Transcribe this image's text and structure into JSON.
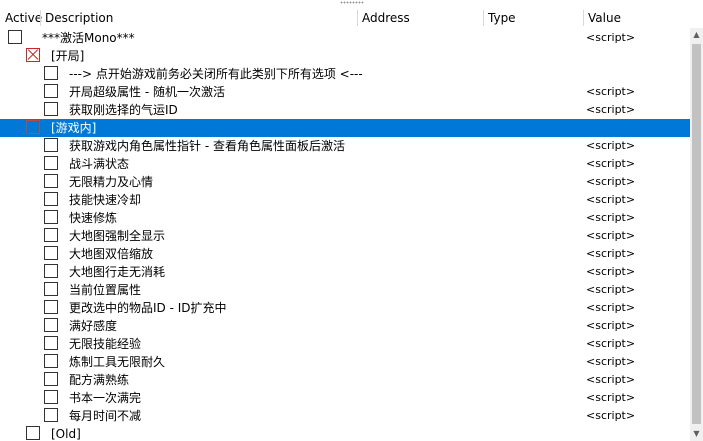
{
  "columns": {
    "active": "Active",
    "description": "Description",
    "address": "Address",
    "type": "Type",
    "value": "Value"
  },
  "rows": [
    {
      "desc": "***激活Mono***",
      "value": "<script>",
      "checked": false
    },
    {
      "desc": "[开局]",
      "value": "",
      "checked": true
    },
    {
      "desc": "--->      点开始游戏前务必关闭所有此类别下所有选项      <---",
      "value": "",
      "checked": false
    },
    {
      "desc": "开局超级属性 - 随机一次激活",
      "value": "<script>",
      "checked": false
    },
    {
      "desc": "获取刚选择的气运ID",
      "value": "<script>",
      "checked": false
    },
    {
      "desc": "[游戏内]",
      "value": "",
      "checked": false,
      "selected": true
    },
    {
      "desc": "获取游戏内角色属性指针 - 查看角色属性面板后激活",
      "value": "<script>",
      "checked": false
    },
    {
      "desc": "战斗满状态",
      "value": "<script>",
      "checked": false
    },
    {
      "desc": "无限精力及心情",
      "value": "<script>",
      "checked": false
    },
    {
      "desc": "技能快速冷却",
      "value": "<script>",
      "checked": false
    },
    {
      "desc": "快速修炼",
      "value": "<script>",
      "checked": false
    },
    {
      "desc": "大地图强制全显示",
      "value": "<script>",
      "checked": false
    },
    {
      "desc": "大地图双倍缩放",
      "value": "<script>",
      "checked": false
    },
    {
      "desc": "大地图行走无消耗",
      "value": "<script>",
      "checked": false
    },
    {
      "desc": "当前位置属性",
      "value": "<script>",
      "checked": false
    },
    {
      "desc": "更改选中的物品ID - ID扩充中",
      "value": "<script>",
      "checked": false
    },
    {
      "desc": "满好感度",
      "value": "<script>",
      "checked": false
    },
    {
      "desc": "无限技能经验",
      "value": "<script>",
      "checked": false
    },
    {
      "desc": "炼制工具无限耐久",
      "value": "<script>",
      "checked": false
    },
    {
      "desc": "配方满熟练",
      "value": "<script>",
      "checked": false
    },
    {
      "desc": "书本一次满完",
      "value": "<script>",
      "checked": false
    },
    {
      "desc": "每月时间不减",
      "value": "<script>",
      "checked": false
    },
    {
      "desc": "[Old]",
      "value": "",
      "checked": false
    }
  ],
  "scrollbar": {
    "up_icon": "arrow-up",
    "down_icon": "arrow-down"
  }
}
